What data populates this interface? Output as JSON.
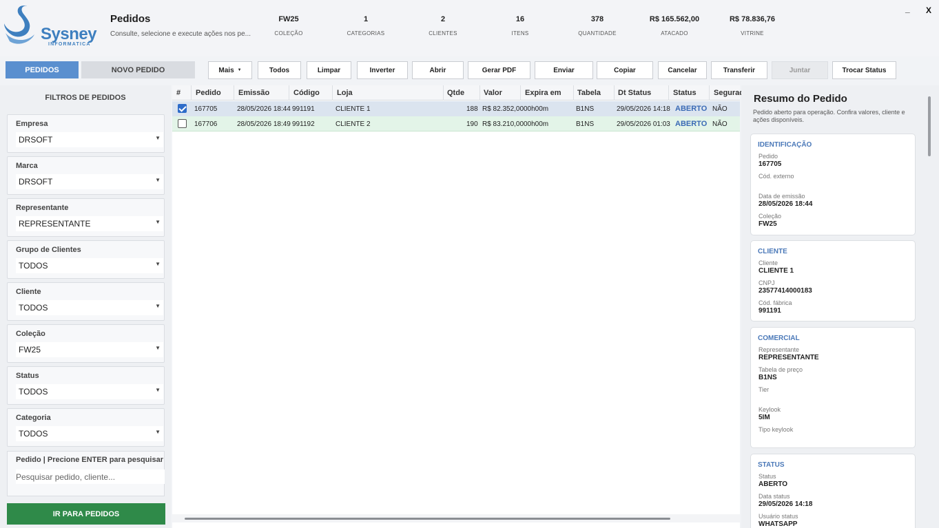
{
  "header": {
    "logo_text": "Sysney",
    "logo_sub": "INFORMATICA",
    "title": "Pedidos",
    "subtitle": "Consulte, selecione e execute ações nos pe...",
    "stats": [
      {
        "value": "FW25",
        "label": "COLEÇÃO"
      },
      {
        "value": "1",
        "label": "CATEGORIAS"
      },
      {
        "value": "2",
        "label": "CLIENTES"
      },
      {
        "value": "16",
        "label": "ITENS"
      },
      {
        "value": "378",
        "label": "QUANTIDADE"
      },
      {
        "value": "R$ 165.562,00",
        "label": "ATACADO"
      },
      {
        "value": "R$ 78.836,76",
        "label": "VITRINE"
      }
    ],
    "minimize": "_",
    "close": "X"
  },
  "tabs": {
    "active": "PEDIDOS",
    "idle": "NOVO PEDIDO"
  },
  "toolbar": {
    "mais": "Mais",
    "todos": "Todos",
    "limpar": "Limpar",
    "inverter": "Inverter",
    "abrir": "Abrir",
    "gerar_pdf": "Gerar PDF",
    "enviar": "Enviar",
    "copiar": "Copiar",
    "cancelar": "Cancelar",
    "transferir": "Transferir",
    "juntar": "Juntar",
    "trocar_status": "Trocar Status"
  },
  "filters": {
    "title": "FILTROS DE PEDIDOS",
    "items": [
      {
        "label": "Empresa",
        "value": "DRSOFT"
      },
      {
        "label": "Marca",
        "value": "DRSOFT"
      },
      {
        "label": "Representante",
        "value": "REPRESENTANTE"
      },
      {
        "label": "Grupo de Clientes",
        "value": "TODOS"
      },
      {
        "label": "Cliente",
        "value": "TODOS"
      },
      {
        "label": "Coleção",
        "value": "FW25"
      },
      {
        "label": "Status",
        "value": "TODOS"
      },
      {
        "label": "Categoria",
        "value": "TODOS"
      }
    ],
    "search_label": "Pedido | Precione ENTER para pesquisar",
    "search_placeholder": "Pesquisar pedido, cliente...",
    "go_button": "IR PARA PEDIDOS"
  },
  "table": {
    "columns": [
      "#",
      "Pedido",
      "Emissão",
      "Código",
      "Loja",
      "Qtde",
      "Valor",
      "Expira em",
      "Tabela",
      "Dt Status",
      "Status",
      "Segurad"
    ],
    "rows": [
      {
        "checked": true,
        "pedido": "167705",
        "emissao": "28/05/2026 18:44",
        "codigo": "991191",
        "loja": "CLIENTE 1",
        "qtde": "188",
        "valor": "R$ 82.352,00",
        "expira": "00h00m",
        "tabela": "B1NS",
        "dt_status": "29/05/2026 14:18",
        "status": "ABERTO",
        "segurado": "NÃO"
      },
      {
        "checked": false,
        "pedido": "167706",
        "emissao": "28/05/2026 18:49",
        "codigo": "991192",
        "loja": "CLIENTE 2",
        "qtde": "190",
        "valor": "R$ 83.210,00",
        "expira": "00h00m",
        "tabela": "B1NS",
        "dt_status": "29/05/2026 01:03",
        "status": "ABERTO",
        "segurado": "NÃO"
      }
    ]
  },
  "summary": {
    "title": "Resumo do Pedido",
    "subtitle": "Pedido aberto para operação. Confira valores, cliente e ações disponíveis.",
    "identificacao": {
      "title": "IDENTIFICAÇÃO",
      "pedido_k": "Pedido",
      "pedido_v": "167705",
      "codext_k": "Cód. externo",
      "codext_v": "",
      "emissao_k": "Data de emissão",
      "emissao_v": "28/05/2026 18:44",
      "colecao_k": "Coleção",
      "colecao_v": "FW25"
    },
    "cliente": {
      "title": "CLIENTE",
      "cliente_k": "Cliente",
      "cliente_v": "CLIENTE 1",
      "cnpj_k": "CNPJ",
      "cnpj_v": "23577414000183",
      "codfab_k": "Cód. fábrica",
      "codfab_v": "991191"
    },
    "comercial": {
      "title": "COMERCIAL",
      "rep_k": "Representante",
      "rep_v": "REPRESENTANTE",
      "tab_k": "Tabela de preço",
      "tab_v": "B1NS",
      "tier_k": "Tier",
      "tier_v": "",
      "keylook_k": "Keylook",
      "keylook_v": "5IM",
      "tipokey_k": "Tipo keylook",
      "tipokey_v": ""
    },
    "status": {
      "title": "STATUS",
      "status_k": "Status",
      "status_v": "ABERTO",
      "data_k": "Data status",
      "data_v": "29/05/2026 14:18",
      "usuario_k": "Usuário status",
      "usuario_v": "WHATSAPP"
    }
  },
  "colors": {
    "accent": "#5a8fcf",
    "go": "#2f8a49",
    "status": "#3a6ab5"
  }
}
